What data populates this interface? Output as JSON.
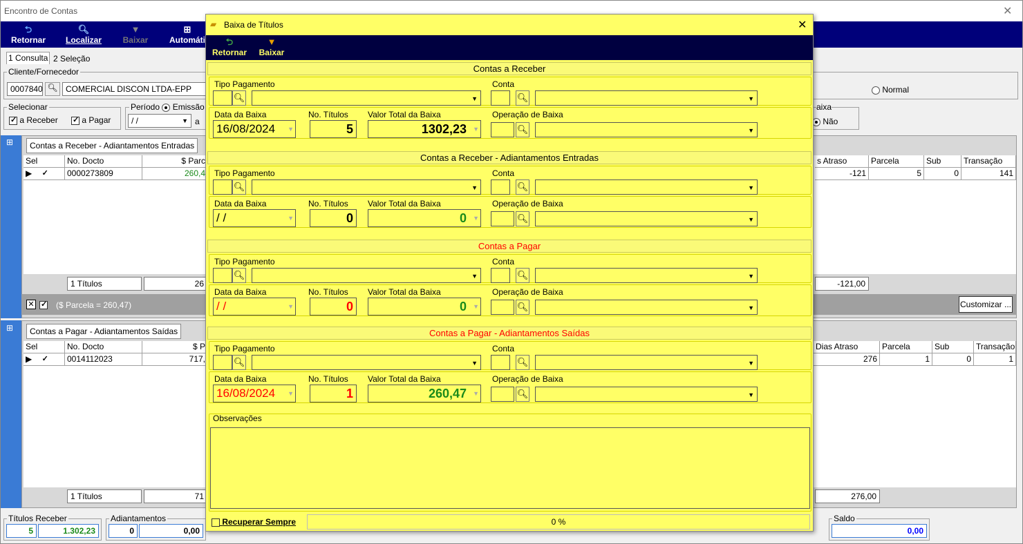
{
  "window": {
    "title": "Encontro de Contas"
  },
  "toolbar": {
    "retornar": "Retornar",
    "localizar": "Localizar",
    "baixar": "Baixar",
    "automatico": "Automáti"
  },
  "tabs": {
    "consulta": "1 Consulta",
    "selecao": "2 Seleção"
  },
  "cliente": {
    "label": "Cliente/Fornecedor",
    "code": "0007840",
    "name": "COMERCIAL DISCON LTDA-EPP"
  },
  "radio_normal": "Normal",
  "selecionar": {
    "label": "Selecionar",
    "receber": "a Receber",
    "pagar": "a Pagar"
  },
  "periodo": {
    "label": "Período",
    "emissao": "Emissão",
    "from": " / /",
    "a": "a"
  },
  "baixa_grp": {
    "label": "aixa",
    "nao": "Não"
  },
  "receber_grid": {
    "tab": "Contas a Receber - Adiantamentos Entradas",
    "headers": {
      "sel": "Sel",
      "docto": "No. Docto",
      "parcela_val": "$ Parc",
      "atraso": "s Atraso",
      "parcela": "Parcela",
      "sub": "Sub",
      "transacao": "Transação"
    },
    "row": {
      "docto": "0000273809",
      "parcela_val": "260,4",
      "atraso": "-121",
      "parcela": "5",
      "sub": "0",
      "transacao": "141"
    },
    "footer": {
      "titulos": "1 Títulos",
      "sum": "26",
      "atraso": "-121,00"
    },
    "status": "($ Parcela = 260,47)",
    "customizar": "Customizar ..."
  },
  "pagar_grid": {
    "tab": "Contas a Pagar -  Adiantamentos Saídas",
    "headers": {
      "sel": "Sel",
      "docto": "No. Docto",
      "parcela_val": "$ P",
      "atraso": "Dias Atraso",
      "parcela": "Parcela",
      "sub": "Sub",
      "transacao": "Transação"
    },
    "row": {
      "docto": "0014112023",
      "parcela_val": "717,",
      "atraso": "276",
      "parcela": "1",
      "sub": "0",
      "transacao": "1"
    },
    "footer": {
      "titulos": "1 Títulos",
      "sum": "71",
      "atraso": "276,00"
    }
  },
  "bottom": {
    "titulos_receber": {
      "label": "Títulos Receber",
      "count": "5",
      "value": "1.302,23"
    },
    "adiantamentos": {
      "label": "Adiantamentos",
      "count": "0",
      "value": "0,00"
    },
    "saldo": {
      "label": "Saldo",
      "value": "0,00"
    }
  },
  "dialog": {
    "title": "Baixa de Títulos",
    "retornar": "Retornar",
    "baixar": "Baixar",
    "labels": {
      "tipo": "Tipo Pagamento",
      "conta": "Conta",
      "data": "Data da Baixa",
      "num": "No. Títulos",
      "valor": "Valor Total da Baixa",
      "operacao": "Operação de Baixa"
    },
    "sections": [
      {
        "title": "Contas a Receber",
        "date": "16/08/2024",
        "num": "5",
        "valor": "1302,23"
      },
      {
        "title": "Contas a Receber - Adiantamentos Entradas",
        "date": " / /",
        "num": "0",
        "valor": "0"
      },
      {
        "title": "Contas a Pagar",
        "date": " / /",
        "num": "0",
        "valor": "0"
      },
      {
        "title": "Contas a Pagar - Adiantamentos Saídas",
        "date": "16/08/2024",
        "num": "1",
        "valor": "260,47"
      }
    ],
    "observacoes": "Observações",
    "recuperar": "Recuperar Sempre",
    "progress": "0 %"
  }
}
